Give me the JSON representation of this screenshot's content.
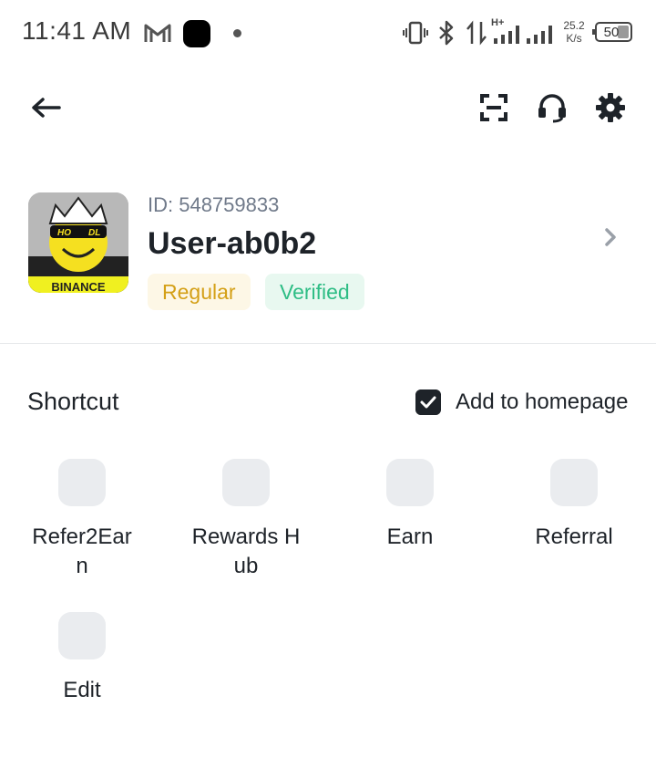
{
  "status_bar": {
    "time": "11:41 AM",
    "net_speed_value": "25.2",
    "net_speed_unit": "K/s",
    "battery": "50",
    "network_type": "H+"
  },
  "toolbar": {
    "back_icon": "arrow-left-icon",
    "scan_icon": "scan-icon",
    "support_icon": "headset-icon",
    "settings_icon": "gear-icon"
  },
  "profile": {
    "id_text": "ID: 548759833",
    "username": "User-ab0b2",
    "tier_badge": "Regular",
    "verification_badge": "Verified",
    "avatar_text_hodl": [
      "HO",
      "DL"
    ],
    "avatar_text_brand": "BINANCE"
  },
  "shortcut": {
    "title": "Shortcut",
    "add_to_homepage_label": "Add to homepage",
    "add_to_homepage_checked": true,
    "items": [
      {
        "label": "Refer2Earn"
      },
      {
        "label": "Rewards Hub"
      },
      {
        "label": "Earn"
      },
      {
        "label": "Referral"
      },
      {
        "label": "Edit"
      }
    ]
  },
  "colors": {
    "regular_badge_bg": "#fdf7e6",
    "regular_badge_text": "#d4a017",
    "verified_badge_bg": "#e8f8f0",
    "verified_badge_text": "#2ebd85",
    "tile_placeholder": "#eaecef"
  }
}
